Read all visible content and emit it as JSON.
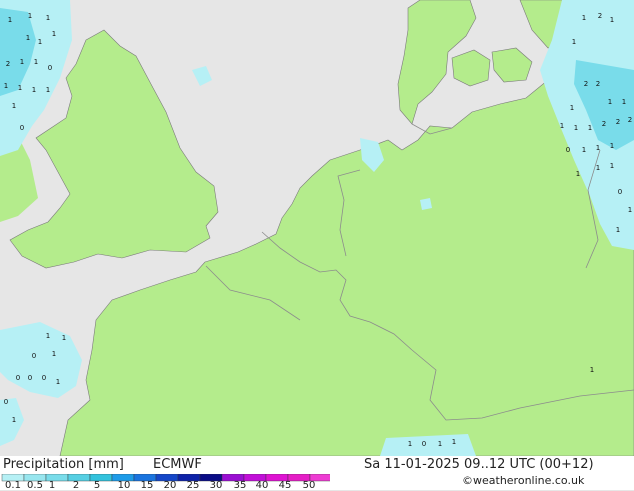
{
  "footer": {
    "title": "Precipitation [mm]",
    "model": "ECMWF",
    "datetime": "Sa 11-01-2025 09..12 UTC (00+12)",
    "credit": "©weatheronline.co.uk"
  },
  "legend": {
    "ticks": [
      "0.1",
      "0.5",
      "1",
      "2",
      "5",
      "10",
      "15",
      "20",
      "25",
      "30",
      "35",
      "40",
      "45",
      "50"
    ],
    "colors": [
      "#b6f0f5",
      "#98e6ef",
      "#79dcea",
      "#56cfe3",
      "#33c2dd",
      "#1e9be8",
      "#1a74df",
      "#1546c8",
      "#0e22a8",
      "#0a0c86",
      "#9a0fd2",
      "#c10fd8",
      "#de13d2",
      "#e51ec6",
      "#ee3cd3"
    ]
  },
  "map": {
    "colors": {
      "sea": "#e6e6e6",
      "land": "#b4ec8c",
      "precip_light": "#b6f0f5",
      "precip_medium": "#79dcea",
      "border": "#8c8c8c",
      "coast": "#7a7a7a"
    },
    "precip_labels": [
      "1",
      "1",
      "1",
      "1",
      "1",
      "1",
      "2",
      "1",
      "1",
      "0",
      "1",
      "1",
      "1",
      "1",
      "1",
      "0",
      "1",
      "2",
      "1",
      "1",
      "2",
      "2",
      "1",
      "1",
      "1",
      "1",
      "2",
      "2",
      "2",
      "1",
      "1",
      "0",
      "1",
      "1",
      "1",
      "1",
      "1",
      "1",
      "0",
      "1",
      "1",
      "1",
      "1",
      "0",
      "1",
      "0",
      "0",
      "0",
      "1",
      "0",
      "1",
      "1",
      "0",
      "1",
      "1",
      "1"
    ]
  }
}
